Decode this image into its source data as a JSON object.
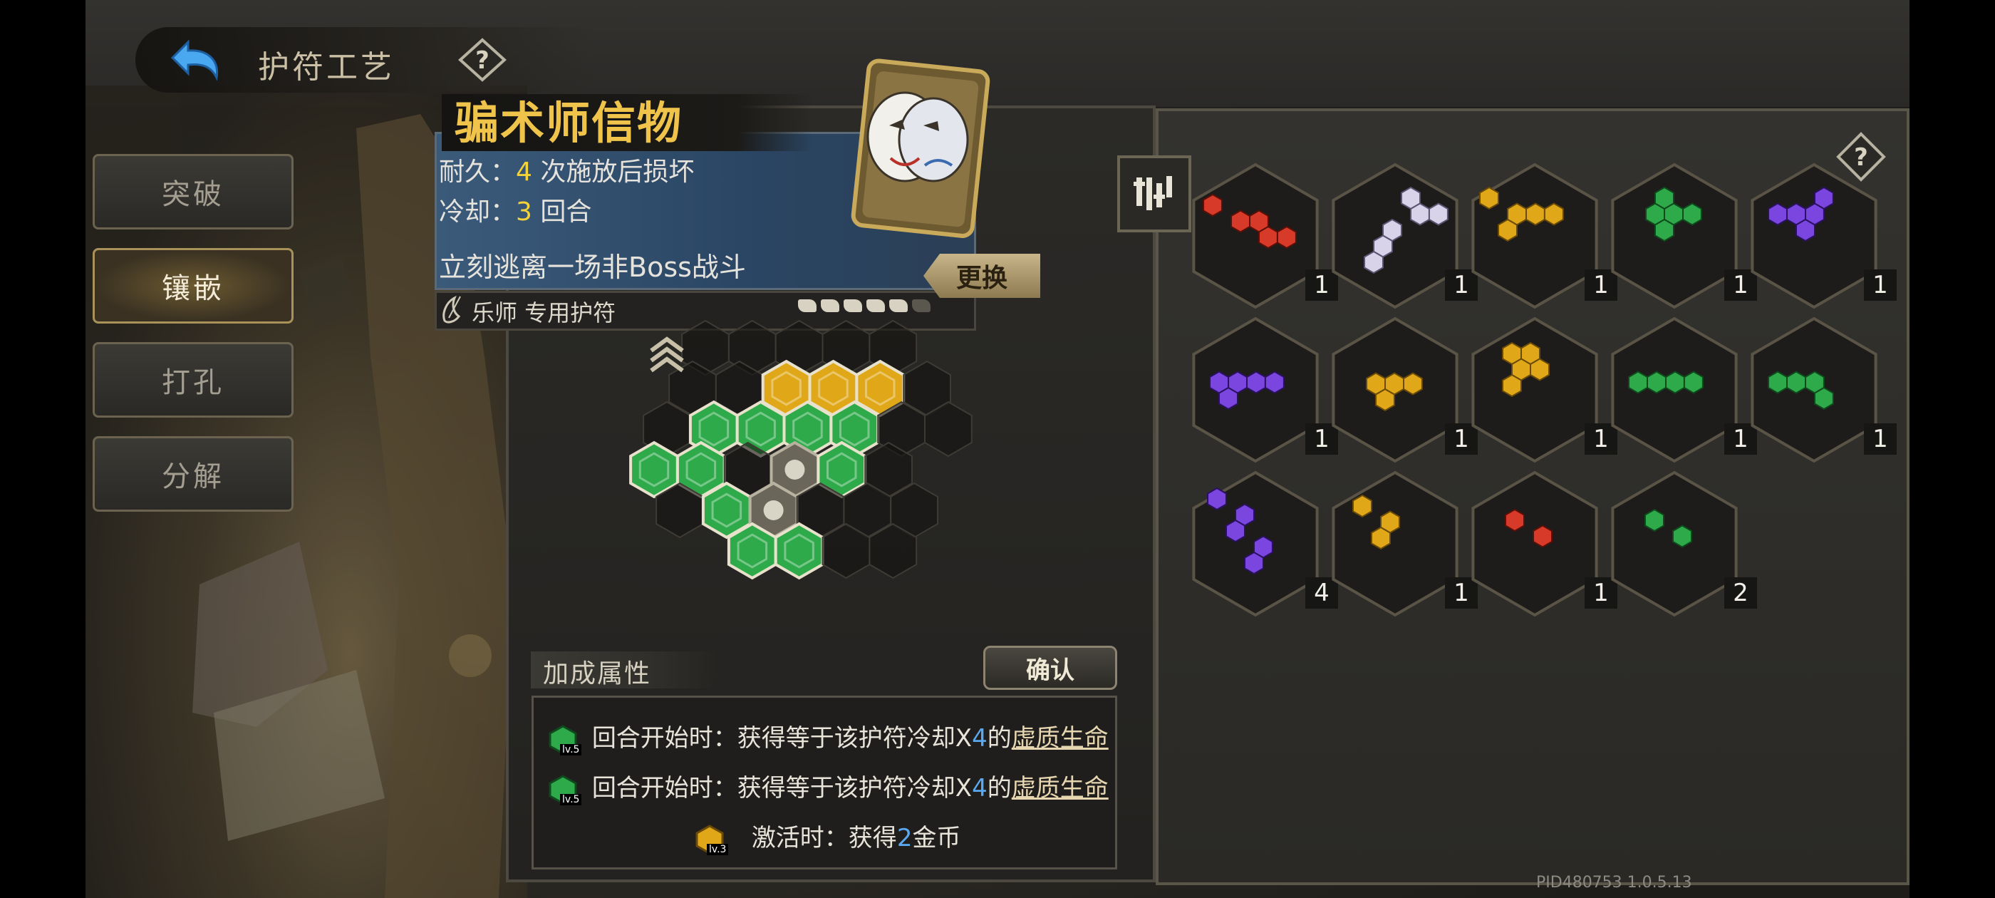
{
  "header": {
    "title": "护符工艺"
  },
  "side_menu": {
    "items": [
      {
        "label": "突破",
        "active": false
      },
      {
        "label": "镶嵌",
        "active": true
      },
      {
        "label": "打孔",
        "active": false
      },
      {
        "label": "分解",
        "active": false
      }
    ]
  },
  "item": {
    "name": "骗术师信物",
    "durability_label": "耐久：",
    "durability_value": "4",
    "durability_suffix": "次施放后损坏",
    "cooldown_label": "冷却：",
    "cooldown_value": "3",
    "cooldown_suffix": "回合",
    "effect": "立刻逃离一场非Boss战斗",
    "class_label": "乐师 专用护符",
    "durability_pips": {
      "filled": 5,
      "total": 6
    },
    "swap_label": "更换"
  },
  "bonus": {
    "title": "加成属性",
    "confirm_label": "确认",
    "lines": [
      {
        "gem_color": "green",
        "level": "lv.5",
        "prefix": "回合开始时：获得等于该护符冷却X",
        "value": "4",
        "mid": "的",
        "link": "虚质生命"
      },
      {
        "gem_color": "green",
        "level": "lv.5",
        "prefix": "回合开始时：获得等于该护符冷却X",
        "value": "4",
        "mid": "的",
        "link": "虚质生命"
      },
      {
        "gem_color": "gold",
        "level": "lv.3",
        "prefix": "激活时：获得",
        "value": "2",
        "mid": "金币",
        "link": ""
      }
    ]
  },
  "inventory": {
    "slots": [
      {
        "color": "red",
        "count": "1"
      },
      {
        "color": "white",
        "count": "1"
      },
      {
        "color": "gold",
        "count": "1"
      },
      {
        "color": "green",
        "count": "1"
      },
      {
        "color": "purple",
        "count": "1"
      },
      {
        "color": "purple",
        "count": "1"
      },
      {
        "color": "gold",
        "count": "1"
      },
      {
        "color": "gold",
        "count": "1"
      },
      {
        "color": "green",
        "count": "1"
      },
      {
        "color": "green",
        "count": "1"
      },
      {
        "color": "purple",
        "count": "4"
      },
      {
        "color": "gold",
        "count": "1"
      },
      {
        "color": "red",
        "count": "1"
      },
      {
        "color": "green",
        "count": "2"
      }
    ]
  },
  "colors": {
    "accent_gold": "#f0c44a",
    "gem_green": "#2faa4a",
    "gem_gold": "#e0a818",
    "gem_red": "#d83a2a",
    "gem_purple": "#7b45e0",
    "gem_white": "#d9d3ea",
    "link_blue": "#5aa8f0"
  },
  "footer": {
    "build": "PID480753  1.0.5.13"
  }
}
